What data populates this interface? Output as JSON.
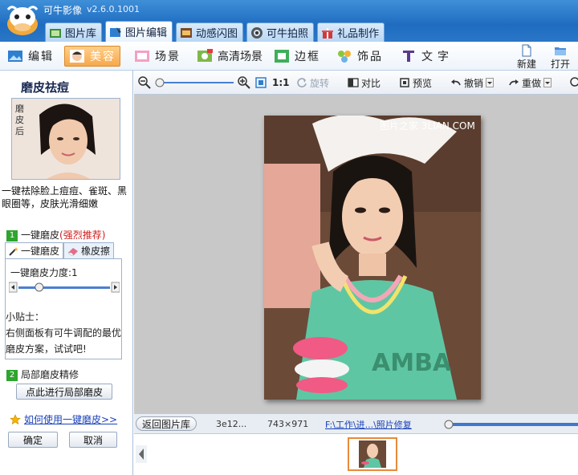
{
  "app": {
    "title": "可牛影像",
    "version": "v2.6.0.1001"
  },
  "tabs": [
    {
      "label": "图片库",
      "icon": "gallery-icon"
    },
    {
      "label": "图片编辑",
      "icon": "image-edit-icon",
      "active": true
    },
    {
      "label": "动感闪图",
      "icon": "animation-icon"
    },
    {
      "label": "可牛拍照",
      "icon": "camera-icon"
    },
    {
      "label": "礼品制作",
      "icon": "gift-icon"
    }
  ],
  "toolbar": {
    "edit": "编辑",
    "beauty": "美容",
    "scene": "场景",
    "hd_scene": "高清场景",
    "frame": "边框",
    "decor": "饰品",
    "text": "文字",
    "new": "新建",
    "open": "打开"
  },
  "left": {
    "title": "磨皮祛痘",
    "preview_label": "磨皮后",
    "description": "一键祛除脸上痘痘、雀斑、黑眼圈等，皮肤光滑细嫩",
    "step1_num": "1",
    "step1_label": "一键磨皮",
    "step1_recommend": "(强烈推荐)",
    "subtab_oneclick": "一键磨皮",
    "subtab_eraser": "橡皮擦",
    "strength_label": "一键磨皮力度:",
    "strength_value": "1",
    "strength_fraction": 0.2,
    "tips_title": "小贴士：",
    "tips_text": "右侧面板有可牛调配的最优磨皮方案，试试吧!",
    "step2_num": "2",
    "step2_label": "局部磨皮精修",
    "local_button": "点此进行局部磨皮",
    "howto_link": "如何使用一键磨皮>>",
    "ok": "确定",
    "cancel": "取消"
  },
  "subtoolbar": {
    "zoom_fraction": 0.0,
    "fit_label": "1:1",
    "rotate": "旋转",
    "compare": "对比",
    "preview": "预览",
    "undo": "撤销",
    "redo": "重做"
  },
  "canvas": {
    "watermark": "图片之家  3LIAN.COM"
  },
  "status": {
    "back": "返回图片库",
    "file_id": "3e12...",
    "dimensions": "743×971",
    "path": "F:\\工作\\进...\\照片修复",
    "zoom_fraction": 0.0
  },
  "colors": {
    "accent": "#f7a84a",
    "title_bar": "#1f6cc0",
    "step": "#2ea52e",
    "recommend": "#d01c1c"
  }
}
